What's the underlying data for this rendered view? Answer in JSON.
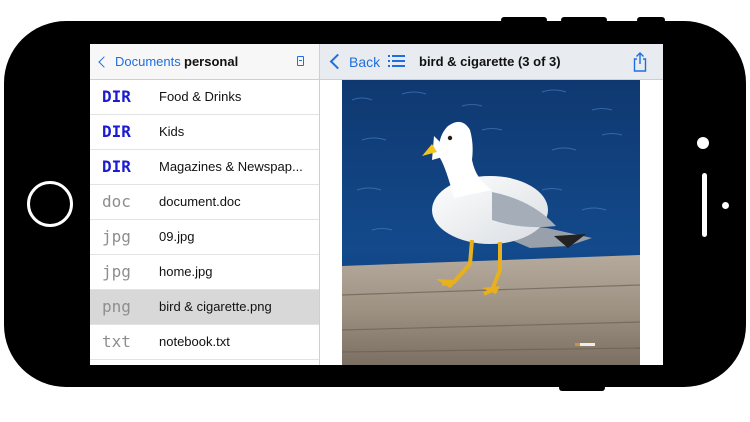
{
  "master": {
    "back_label": "Documents",
    "title": "personal",
    "items": [
      {
        "ext": "DIR",
        "kind": "dir",
        "name": "Food & Drinks",
        "selected": false
      },
      {
        "ext": "DIR",
        "kind": "dir",
        "name": "Kids",
        "selected": false
      },
      {
        "ext": "DIR",
        "kind": "dir",
        "name": "Magazines & Newspap...",
        "selected": false
      },
      {
        "ext": "doc",
        "kind": "file",
        "name": "document.doc",
        "selected": false
      },
      {
        "ext": "jpg",
        "kind": "file",
        "name": "09.jpg",
        "selected": false
      },
      {
        "ext": "jpg",
        "kind": "file",
        "name": "home.jpg",
        "selected": false
      },
      {
        "ext": "png",
        "kind": "file",
        "name": "bird & cigarette.png",
        "selected": true
      },
      {
        "ext": "txt",
        "kind": "file",
        "name": "notebook.txt",
        "selected": false
      }
    ]
  },
  "detail": {
    "back_label": "Back",
    "title": "bird & cigarette (3 of 3)"
  },
  "colors": {
    "accent": "#1f6fe0",
    "dir_text": "#1b1bd0",
    "file_ext": "#8e8e8e",
    "selected_row": "#d8d8d8"
  },
  "icons": [
    "chevron-left-icon",
    "document-icon",
    "list-icon",
    "share-icon"
  ]
}
